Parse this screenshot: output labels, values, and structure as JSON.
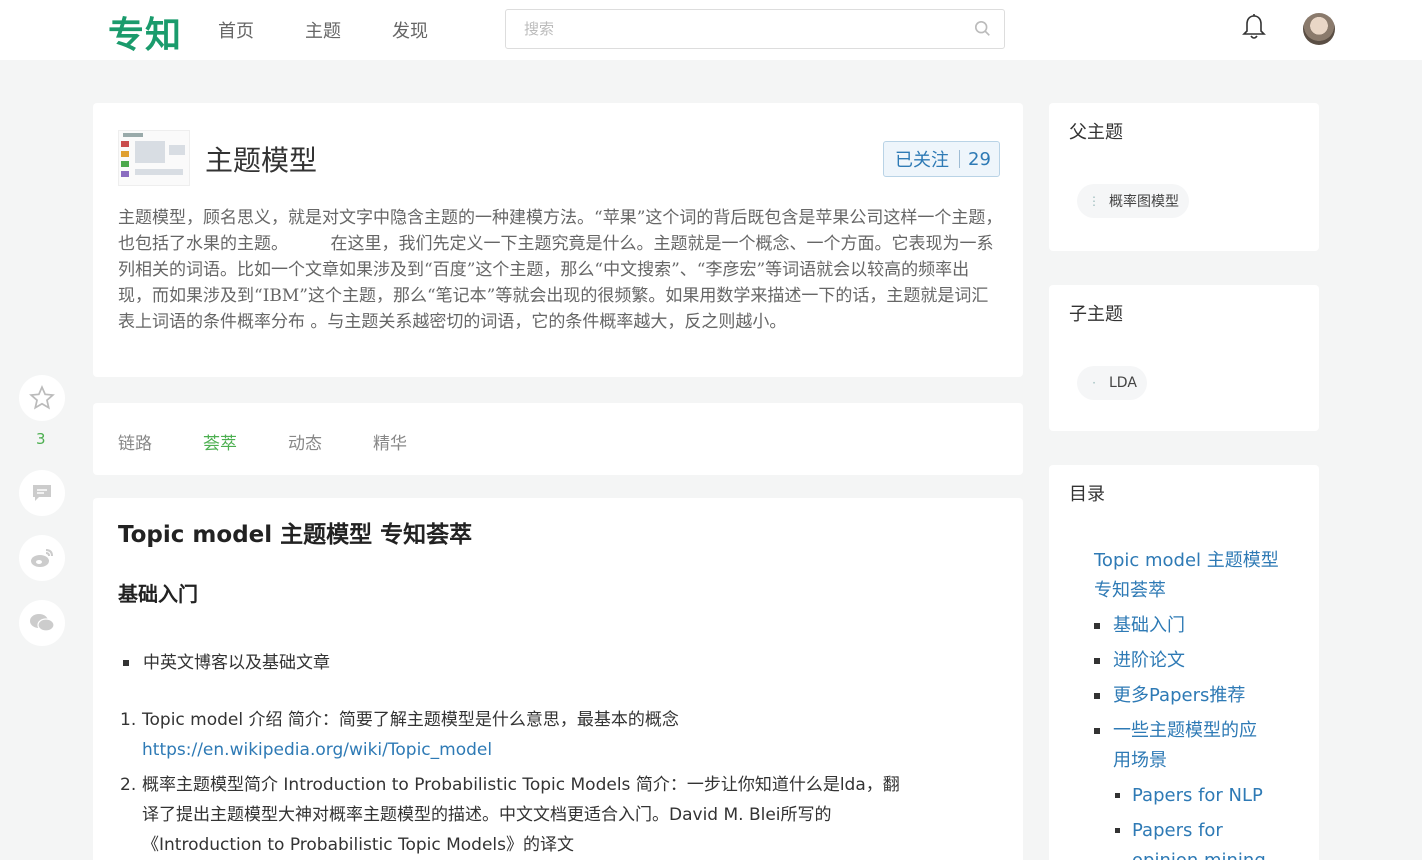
{
  "header": {
    "logo": "专知",
    "nav": [
      "首页",
      "主题",
      "发现"
    ],
    "search_placeholder": "搜索"
  },
  "topic": {
    "title": "主题模型",
    "follow_label": "已关注",
    "follow_count": "29",
    "description": "主题模型，顾名思义，就是对文字中隐含主题的一种建模方法。“苹果”这个词的背后既包含是苹果公司这样一个主题，也包括了水果的主题。　　　在这里，我们先定义一下主题究竟是什么。主题就是一个概念、一个方面。它表现为一系列相关的词语。比如一个文章如果涉及到“百度”这个主题，那么“中文搜索”、“李彦宏”等词语就会以较高的频率出现，而如果涉及到“IBM”这个主题，那么“笔记本”等就会出现的很频繁。如果用数学来描述一下的话，主题就是词汇表上词语的条件概率分布 。与主题关系越密切的词语，它的条件概率越大，反之则越小。"
  },
  "tabs": [
    "链路",
    "荟萃",
    "动态",
    "精华"
  ],
  "active_tab": "荟萃",
  "sidebar_left": {
    "star_count": "3",
    "icons": [
      "star-icon",
      "comment-icon",
      "weibo-icon",
      "wechat-icon"
    ]
  },
  "content": {
    "h1": "Topic model 主题模型 专知荟萃",
    "h2": "基础入门",
    "bullet": "中英文博客以及基础文章",
    "items": [
      {
        "num": "1.",
        "text": "Topic model 介绍 简介：简要了解主题模型是什么意思，最基本的概念",
        "link": "https://en.wikipedia.org/wiki/Topic_model"
      },
      {
        "num": "2.",
        "line1": "概率主题模型简介 Introduction to Probabilistic Topic Models 简介：一步让你知道什么是lda，翻",
        "line2": "译了提出主题模型大神对概率主题模型的描述。中文文档更适合入门。David M. Blei所写的",
        "line3": "《Introduction to Probabilistic Topic Models》的译文"
      }
    ]
  },
  "right": {
    "parent_title": "父主题",
    "parent_tag": "概率图模型",
    "child_title": "子主题",
    "child_tag": "LDA",
    "toc_title": "目录",
    "toc": {
      "main_line1": "Topic model 主题模型",
      "main_line2": "专知荟萃",
      "items": [
        "基础入门",
        "进阶论文",
        "更多Papers推荐"
      ],
      "item4_line1": "一些主题模型的应",
      "item4_line2": "用场景",
      "sub1": "Papers for NLP",
      "sub2_line1": "Papers for",
      "sub2_line2": "opinion mining"
    }
  },
  "colors": {
    "brand": "#1a9b6c",
    "active_tab": "#4caf50",
    "link": "#2e7ab5"
  }
}
